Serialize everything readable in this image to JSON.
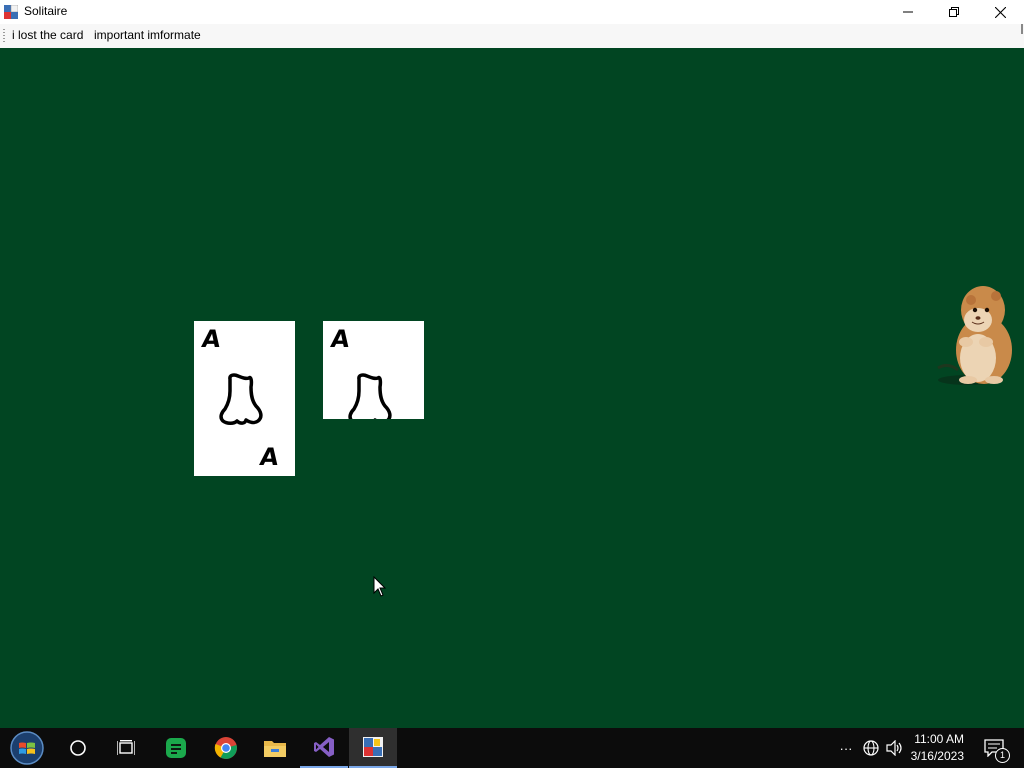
{
  "window": {
    "title": "Solitaire",
    "minimize_icon": "minimize-icon",
    "restore_icon": "restore-icon",
    "close_icon": "close-icon"
  },
  "menu": {
    "items": [
      "i lost the card",
      "important imformate"
    ]
  },
  "game": {
    "background_color": "#014522",
    "cards": [
      {
        "rank_top": "A",
        "rank_bottom": "A",
        "suit_drawing": "hand-drawn-boot-shape"
      },
      {
        "rank_top": "A",
        "suit_drawing": "hand-drawn-boot-shape"
      }
    ],
    "mascot": "hamster-image"
  },
  "taskbar": {
    "apps": [
      "start-button",
      "search-icon",
      "task-view-icon",
      "messages-app-icon",
      "chrome-icon",
      "file-explorer-icon",
      "visual-studio-icon",
      "solitaire-app-icon"
    ],
    "clock": {
      "time": "11:00 AM",
      "date": "3/16/2023"
    },
    "tray": {
      "overflow": "···",
      "notification_count": "1"
    }
  }
}
